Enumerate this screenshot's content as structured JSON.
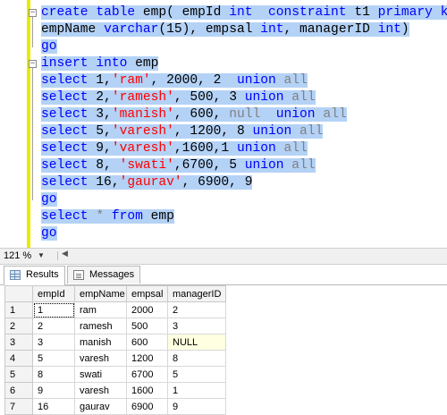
{
  "editor": {
    "lines": [
      {
        "segments": [
          {
            "t": "create",
            "c": "kw"
          },
          {
            "t": " "
          },
          {
            "t": "table",
            "c": "kw"
          },
          {
            "t": " emp( empId "
          },
          {
            "t": "int",
            "c": "kw"
          },
          {
            "t": "  "
          },
          {
            "t": "constraint",
            "c": "kw"
          },
          {
            "t": " t1 "
          },
          {
            "t": "primary key",
            "c": "kw"
          },
          {
            "t": ","
          }
        ]
      },
      {
        "segments": [
          {
            "t": "empName "
          },
          {
            "t": "varchar",
            "c": "kw"
          },
          {
            "t": "(15), empsal "
          },
          {
            "t": "int",
            "c": "kw"
          },
          {
            "t": ", managerID "
          },
          {
            "t": "int",
            "c": "kw"
          },
          {
            "t": ")"
          }
        ]
      },
      {
        "segments": [
          {
            "t": "go",
            "c": "kw"
          }
        ]
      },
      {
        "segments": [
          {
            "t": "insert",
            "c": "kw"
          },
          {
            "t": " "
          },
          {
            "t": "into",
            "c": "kw"
          },
          {
            "t": " emp"
          }
        ]
      },
      {
        "segments": [
          {
            "t": "select",
            "c": "kw"
          },
          {
            "t": " 1,"
          },
          {
            "t": "'ram'",
            "c": "str"
          },
          {
            "t": ", 2000, 2  "
          },
          {
            "t": "union",
            "c": "kw"
          },
          {
            "t": " "
          },
          {
            "t": "all",
            "c": "gray"
          }
        ]
      },
      {
        "segments": [
          {
            "t": "select",
            "c": "kw"
          },
          {
            "t": " 2,"
          },
          {
            "t": "'ramesh'",
            "c": "str"
          },
          {
            "t": ", 500, 3 "
          },
          {
            "t": "union",
            "c": "kw"
          },
          {
            "t": " "
          },
          {
            "t": "all",
            "c": "gray"
          }
        ]
      },
      {
        "segments": [
          {
            "t": "select",
            "c": "kw"
          },
          {
            "t": " 3,"
          },
          {
            "t": "'manish'",
            "c": "str"
          },
          {
            "t": ", 600, "
          },
          {
            "t": "null",
            "c": "gray"
          },
          {
            "t": "  "
          },
          {
            "t": "union",
            "c": "kw"
          },
          {
            "t": " "
          },
          {
            "t": "all",
            "c": "gray"
          }
        ]
      },
      {
        "segments": [
          {
            "t": "select",
            "c": "kw"
          },
          {
            "t": " 5,"
          },
          {
            "t": "'varesh'",
            "c": "str"
          },
          {
            "t": ", 1200, 8 "
          },
          {
            "t": "union",
            "c": "kw"
          },
          {
            "t": " "
          },
          {
            "t": "all",
            "c": "gray"
          }
        ]
      },
      {
        "segments": [
          {
            "t": "select",
            "c": "kw"
          },
          {
            "t": " 9,"
          },
          {
            "t": "'varesh'",
            "c": "str"
          },
          {
            "t": ",1600,1 "
          },
          {
            "t": "union",
            "c": "kw"
          },
          {
            "t": " "
          },
          {
            "t": "all",
            "c": "gray"
          }
        ]
      },
      {
        "segments": [
          {
            "t": "select",
            "c": "kw"
          },
          {
            "t": " 8, "
          },
          {
            "t": "'swati'",
            "c": "str"
          },
          {
            "t": ",6700, 5 "
          },
          {
            "t": "union",
            "c": "kw"
          },
          {
            "t": " "
          },
          {
            "t": "all",
            "c": "gray"
          }
        ]
      },
      {
        "segments": [
          {
            "t": "select",
            "c": "kw"
          },
          {
            "t": " 16,"
          },
          {
            "t": "'gaurav'",
            "c": "str"
          },
          {
            "t": ", 6900, 9"
          }
        ]
      },
      {
        "segments": [
          {
            "t": "go",
            "c": "kw"
          }
        ]
      },
      {
        "segments": [
          {
            "t": "select",
            "c": "kw"
          },
          {
            "t": " "
          },
          {
            "t": "*",
            "c": "gray"
          },
          {
            "t": " "
          },
          {
            "t": "from",
            "c": "kw"
          },
          {
            "t": " emp"
          }
        ]
      },
      {
        "segments": [
          {
            "t": "go",
            "c": "kw"
          }
        ]
      }
    ]
  },
  "zoombar": {
    "zoom": "121 %"
  },
  "tabs": {
    "results": "Results",
    "messages": "Messages"
  },
  "grid": {
    "columns": [
      "empId",
      "empName",
      "empsal",
      "managerID"
    ],
    "rows": [
      {
        "n": "1",
        "cells": [
          "1",
          "ram",
          "2000",
          "2"
        ]
      },
      {
        "n": "2",
        "cells": [
          "2",
          "ramesh",
          "500",
          "3"
        ]
      },
      {
        "n": "3",
        "cells": [
          "3",
          "manish",
          "600",
          "NULL"
        ]
      },
      {
        "n": "4",
        "cells": [
          "5",
          "varesh",
          "1200",
          "8"
        ]
      },
      {
        "n": "5",
        "cells": [
          "8",
          "swati",
          "6700",
          "5"
        ]
      },
      {
        "n": "6",
        "cells": [
          "9",
          "varesh",
          "1600",
          "1"
        ]
      },
      {
        "n": "7",
        "cells": [
          "16",
          "gaurav",
          "6900",
          "9"
        ]
      }
    ]
  },
  "colors": {
    "selection": "#b4d2f6",
    "keyword": "#0000ff",
    "string": "#ff0000",
    "null_cell": "#ffffe1"
  }
}
